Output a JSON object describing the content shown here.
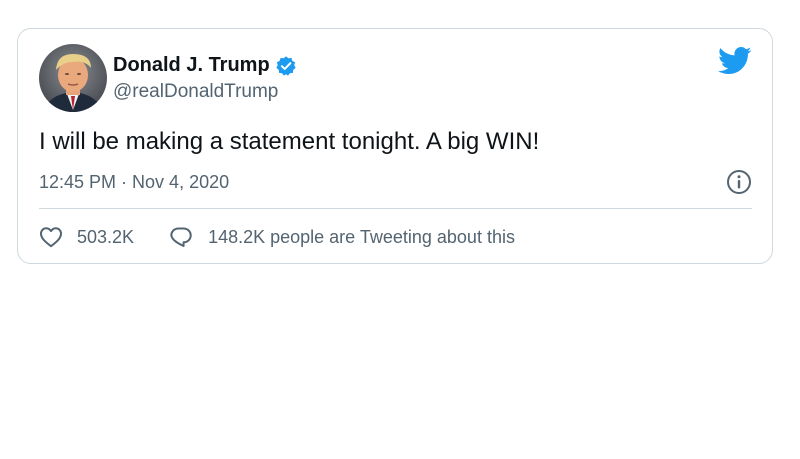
{
  "author": {
    "display_name": "Donald J. Trump",
    "handle": "@realDonaldTrump",
    "verified": true,
    "avatar_icon": "profile-photo"
  },
  "tweet": {
    "text": "I will be making a statement tonight. A big WIN!",
    "timestamp": "12:45 PM · Nov 4, 2020"
  },
  "actions": {
    "like_count": "503.2K",
    "tweeting_text": "148.2K people are Tweeting about this"
  },
  "icons": {
    "brand": "twitter-bird-icon",
    "verified": "verified-badge-icon",
    "info": "info-icon",
    "like": "heart-icon",
    "reply": "speech-bubble-icon"
  },
  "colors": {
    "twitter_blue": "#1d9bf0",
    "text_primary": "#0f1419",
    "text_secondary": "#536471",
    "border": "#cfd9de"
  }
}
